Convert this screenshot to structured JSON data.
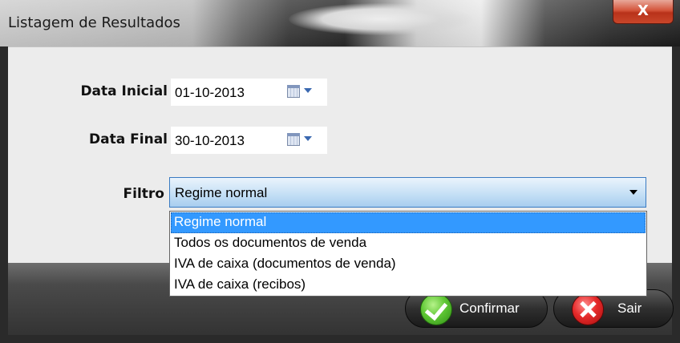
{
  "window": {
    "title": "Listagem de Resultados",
    "close_label": "X"
  },
  "form": {
    "data_inicial": {
      "label": "Data Inicial",
      "value": "01-10-2013"
    },
    "data_final": {
      "label": "Data Final",
      "value": "30-10-2013"
    },
    "filtro": {
      "label": "Filtro",
      "value": "Regime normal",
      "options": [
        "Regime normal",
        "Todos os documentos de venda",
        "IVA de caixa (documentos de venda)",
        "IVA de caixa (recibos)"
      ],
      "highlighted_index": 0
    }
  },
  "buttons": {
    "confirm_label": "Confirmar",
    "exit_label": "Sair"
  },
  "icons": {
    "calendar": "calendar-icon",
    "dropdown": "chevron-down-icon",
    "confirm": "check-icon",
    "exit": "close-icon"
  },
  "colors": {
    "selection": "#3399ff",
    "close_button": "#c9462a",
    "confirm_icon": "#5fc734",
    "exit_icon": "#e52a2a"
  }
}
